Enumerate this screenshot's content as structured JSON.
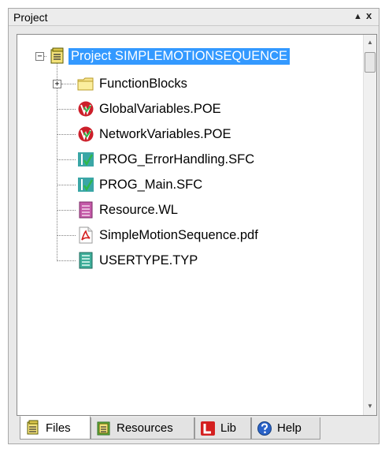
{
  "panel": {
    "title": "Project",
    "pin_glyph": "▲",
    "close_glyph": "x"
  },
  "tree": {
    "expander_root": "−",
    "expander_child": "+",
    "root": {
      "label": "Project SIMPLEMOTIONSEQUENCE",
      "icon": "project-icon",
      "selected": true
    },
    "items": [
      {
        "label": "FunctionBlocks",
        "icon": "folder-icon"
      },
      {
        "label": "GlobalVariables.POE",
        "icon": "poe-icon"
      },
      {
        "label": "NetworkVariables.POE",
        "icon": "poe-icon"
      },
      {
        "label": "PROG_ErrorHandling.SFC",
        "icon": "sfc-icon"
      },
      {
        "label": "PROG_Main.SFC",
        "icon": "sfc-icon"
      },
      {
        "label": "Resource.WL",
        "icon": "resource-icon"
      },
      {
        "label": "SimpleMotionSequence.pdf",
        "icon": "pdf-icon"
      },
      {
        "label": "USERTYPE.TYP",
        "icon": "usertype-icon"
      }
    ]
  },
  "scrollbar": {
    "up_glyph": "▲",
    "down_glyph": "▼"
  },
  "tabs": [
    {
      "label": "Files",
      "icon": "files-icon",
      "active": true
    },
    {
      "label": "Resources",
      "icon": "resources-icon",
      "active": false
    },
    {
      "label": "Lib",
      "icon": "lib-icon",
      "active": false
    },
    {
      "label": "Help",
      "icon": "help-icon",
      "active": false
    }
  ],
  "colors": {
    "selection": "#3399ff",
    "poe_red": "#cc1f2a",
    "sfc_teal": "#3aa6a6",
    "pdf_red": "#d42020",
    "folder_yellow": "#f6e28a"
  }
}
